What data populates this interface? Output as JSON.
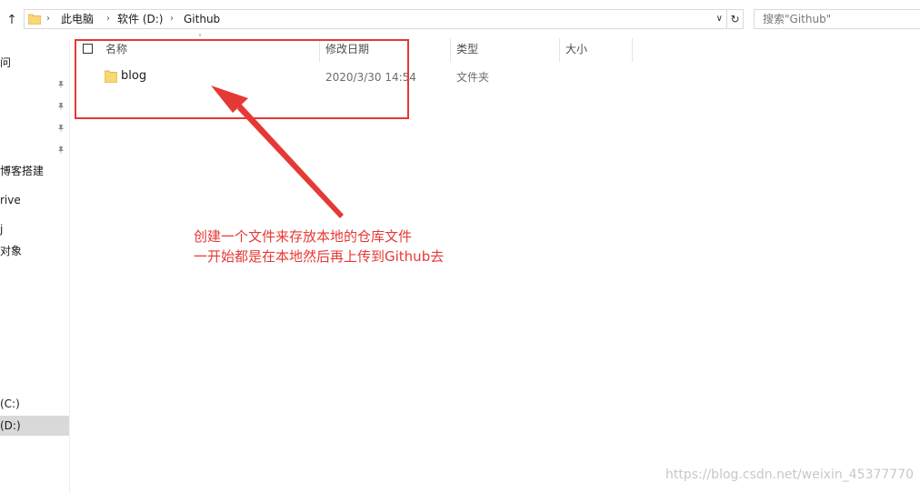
{
  "breadcrumb": {
    "items": [
      "此电脑",
      "软件 (D:)",
      "Github"
    ]
  },
  "search": {
    "placeholder": "搜索\"Github\""
  },
  "nav": {
    "items": [
      "问",
      "博客搭建",
      "rive",
      "j",
      "对象",
      "(C:)",
      "(D:)"
    ]
  },
  "file_list": {
    "columns": [
      "名称",
      "修改日期",
      "类型",
      "大小"
    ],
    "rows": [
      {
        "name": "blog",
        "modified": "2020/3/30 14:54",
        "type": "文件夹",
        "size": ""
      }
    ]
  },
  "annotation": {
    "line1": "创建一个文件来存放本地的仓库文件",
    "line2": "一开始都是在本地然后再上传到Github去"
  },
  "watermark": "https://blog.csdn.net/weixin_45377770",
  "colors": {
    "annotation": "#e53935",
    "folder": "#f8d775",
    "selection": "#d9d9d9"
  },
  "icons": [
    "up-arrow-icon",
    "folder-icon",
    "chevron-right-icon",
    "chevron-down-icon",
    "refresh-icon",
    "pin-icon"
  ]
}
